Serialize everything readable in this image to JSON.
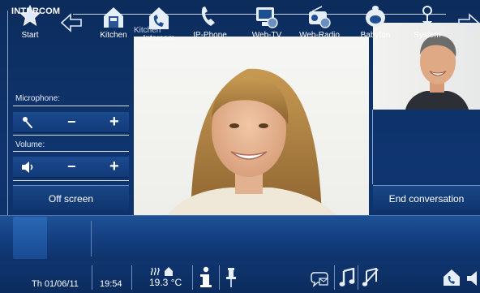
{
  "app": {
    "title": "INTERCOM"
  },
  "camera": {
    "label": "Kitchen"
  },
  "microphone": {
    "label": "Microphone:",
    "minus": "−",
    "plus": "+"
  },
  "volume": {
    "label": "Volume:",
    "minus": "−",
    "plus": "+"
  },
  "buttons": {
    "off_screen": "Off screen",
    "end_conversation": "End conversation"
  },
  "nav": {
    "items": [
      {
        "label": "Start",
        "icon": "star-icon"
      },
      {
        "label": "Kitchen",
        "icon": "kitchen-icon"
      },
      {
        "label": "Intercom",
        "icon": "intercom-icon"
      },
      {
        "label": "IP-Phone",
        "icon": "phone-icon"
      },
      {
        "label": "Web-TV",
        "icon": "web-tv-icon"
      },
      {
        "label": "Web-Radio",
        "icon": "web-radio-icon"
      },
      {
        "label": "Babyfon",
        "icon": "babyfon-icon"
      },
      {
        "label": "System",
        "icon": "system-icon"
      }
    ]
  },
  "status": {
    "date": "Th 01/06/11",
    "time": "19:54",
    "temperature": "19.3 °C"
  },
  "colors": {
    "background": "#0d2d5e",
    "accent": "#2a67b4",
    "text": "#ffffff"
  }
}
